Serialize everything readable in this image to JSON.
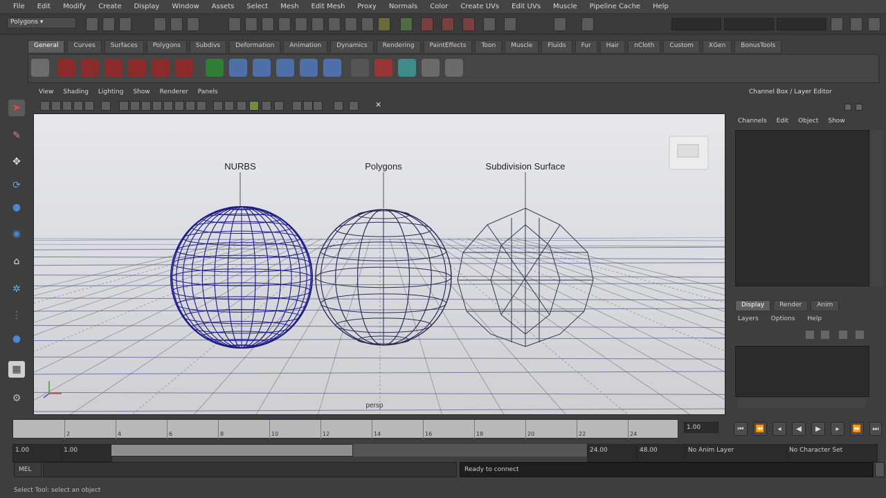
{
  "menubar": {
    "items": [
      "File",
      "Edit",
      "Modify",
      "Create",
      "Display",
      "Window",
      "Assets",
      "Select",
      "Mesh",
      "Edit Mesh",
      "Proxy",
      "Normals",
      "Color",
      "Create UVs",
      "Edit UVs",
      "Muscle",
      "Pipeline Cache",
      "Help"
    ]
  },
  "statusline": {
    "mode": "Polygons"
  },
  "shelf": {
    "tabs": [
      "General",
      "Curves",
      "Surfaces",
      "Polygons",
      "Subdivs",
      "Deformation",
      "Animation",
      "Dynamics",
      "Rendering",
      "PaintEffects",
      "Toon",
      "Muscle",
      "Fluids",
      "Fur",
      "Hair",
      "nCloth",
      "Custom",
      "XGen",
      "BonusTools"
    ],
    "active_tab": "General"
  },
  "panel": {
    "menu": [
      "View",
      "Shading",
      "Lighting",
      "Show",
      "Renderer",
      "Panels"
    ]
  },
  "viewport": {
    "labels": {
      "nurbs": "NURBS",
      "polygons": "Polygons",
      "subdiv": "Subdivision Surface"
    },
    "camera": "persp"
  },
  "right_panel": {
    "title": "Channel Box / Layer Editor",
    "menu": [
      "Channels",
      "Edit",
      "Object",
      "Show"
    ],
    "tabs": [
      "Display",
      "Render",
      "Anim"
    ],
    "active_tab": "Display",
    "sub_menu": [
      "Layers",
      "Options",
      "Help"
    ]
  },
  "timeline": {
    "ticks": [
      "2",
      "4",
      "6",
      "8",
      "10",
      "12",
      "14",
      "16",
      "18",
      "20",
      "22",
      "24"
    ],
    "current_frame": "1.00"
  },
  "range": {
    "start": "1.00",
    "inner_start": "1.00",
    "end_inner": "24.00",
    "end": "48.00",
    "anim_layer": "No Anim Layer",
    "char_set": "No Character Set"
  },
  "command_line": {
    "language": "MEL",
    "result": "Ready to connect"
  },
  "help_line": "Select Tool: select an object",
  "colors": {
    "viewport_bg": "#d7d7d7",
    "grid": "#5a5a8c",
    "wire_nurbs": "#1e1e8a",
    "wire_poly": "#2a2a55",
    "wire_subdiv": "#333344"
  }
}
